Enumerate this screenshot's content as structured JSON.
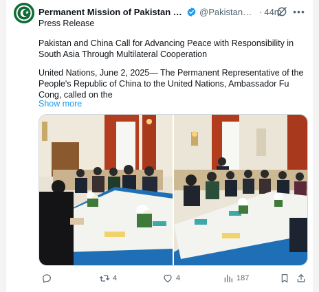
{
  "tweet": {
    "display_name": "Permanent Mission of Pakistan to the United Nations",
    "handle": "@PakistanUN_NY",
    "separator": "·",
    "time": "44m",
    "lines": {
      "press_release": "Press Release",
      "headline": "Pakistan and China Call for Advancing Peace with Responsibility in South Asia Through Multilateral Cooperation",
      "body": "United Nations, June 2, 2025— The Permanent Representative of the People's Republic of China to the United Nations, Ambassador Fu Cong, called on the"
    },
    "show_more": "Show more"
  },
  "actions": {
    "reply_count": "",
    "repost_count": "4",
    "like_count": "4",
    "views_count": "187"
  },
  "icons": [
    "avatar-logo",
    "verified-badge-icon",
    "grok-icon",
    "more-icon",
    "reply-icon",
    "repost-icon",
    "like-icon",
    "views-icon",
    "bookmark-icon",
    "share-icon"
  ],
  "colors": {
    "link": "#1d9bf0",
    "secondary_text": "#536471",
    "avatar_green": "#116b35",
    "tablecloth_blue": "#1e6fb5"
  }
}
